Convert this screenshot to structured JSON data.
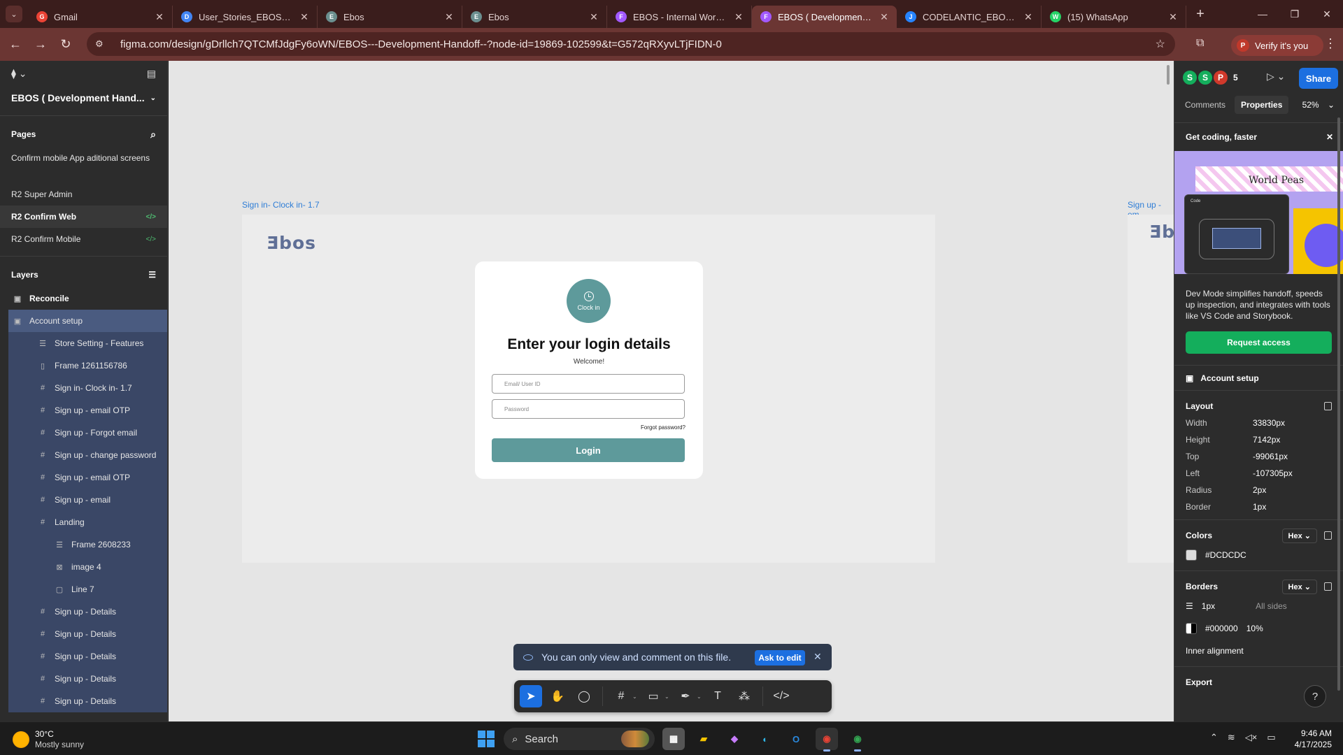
{
  "browser": {
    "tabs": [
      {
        "title": "Gmail",
        "fav": "G",
        "color": "#ea4335",
        "active": false
      },
      {
        "title": "User_Stories_EBOS_V2.1.1",
        "fav": "D",
        "color": "#4285f4",
        "active": false
      },
      {
        "title": "Ebos",
        "fav": "E",
        "color": "#6b8f8f",
        "active": false
      },
      {
        "title": "Ebos",
        "fav": "E",
        "color": "#6b8f8f",
        "active": false
      },
      {
        "title": "EBOS - Internal Workplace",
        "fav": "F",
        "color": "#a259ff",
        "active": false
      },
      {
        "title": "EBOS ( Development Handoff )",
        "fav": "F",
        "color": "#a259ff",
        "active": true
      },
      {
        "title": "CODELANTIC_EBOS - Backlog",
        "fav": "J",
        "color": "#2684ff",
        "active": false
      },
      {
        "title": "(15) WhatsApp",
        "fav": "W",
        "color": "#25d366",
        "active": false
      }
    ],
    "url": "figma.com/design/gDrllch7QTCMfJdgFy6oWN/EBOS---Development-Handoff--?node-id=19869-102599&t=G572qRXyvLTjFIDN-0",
    "verify_label": "Verify it's you",
    "verify_avatar": "P"
  },
  "left": {
    "file_title": "EBOS ( Development Hand...",
    "pages_label": "Pages",
    "pages": [
      {
        "label": "Confirm mobile App aditional screens",
        "selected": false,
        "dev": false
      },
      {
        "label": "R2 Super Admin",
        "selected": false,
        "dev": false
      },
      {
        "label": "R2 Confirm Web",
        "selected": true,
        "dev": true
      },
      {
        "label": "R2 Confirm Mobile",
        "selected": false,
        "dev": true
      }
    ],
    "layers_label": "Layers",
    "layers": [
      {
        "label": "Reconcile",
        "level": "top",
        "icon": "▣"
      },
      {
        "label": "Account setup",
        "level": "sel",
        "icon": "▣"
      },
      {
        "label": "Store Setting - Features",
        "level": "child",
        "icon": "☰"
      },
      {
        "label": "Frame 1261156786",
        "level": "child",
        "icon": "▯"
      },
      {
        "label": "Sign in- Clock in- 1.7",
        "level": "child",
        "icon": "#"
      },
      {
        "label": "Sign up - email OTP",
        "level": "child",
        "icon": "#"
      },
      {
        "label": "Sign up - Forgot email",
        "level": "child",
        "icon": "#"
      },
      {
        "label": "Sign up - change password",
        "level": "child",
        "icon": "#"
      },
      {
        "label": "Sign up - email OTP",
        "level": "child",
        "icon": "#"
      },
      {
        "label": "Sign up - email",
        "level": "child",
        "icon": "#"
      },
      {
        "label": "Landing",
        "level": "child",
        "icon": "#"
      },
      {
        "label": "Frame 2608233",
        "level": "gchild",
        "icon": "☰"
      },
      {
        "label": "image 4",
        "level": "gchild",
        "icon": "⊠"
      },
      {
        "label": "Line 7",
        "level": "gchild",
        "icon": "▢"
      },
      {
        "label": "Sign up - Details",
        "level": "child",
        "icon": "#"
      },
      {
        "label": "Sign up - Details",
        "level": "child",
        "icon": "#"
      },
      {
        "label": "Sign up - Details",
        "level": "child",
        "icon": "#"
      },
      {
        "label": "Sign up - Details",
        "level": "child",
        "icon": "#"
      },
      {
        "label": "Sign up - Details",
        "level": "child",
        "icon": "#"
      }
    ]
  },
  "canvas": {
    "frame1_label": "Sign in- Clock in- 1.7",
    "frame2_label": "Sign up - em",
    "logo": "Ǝbos",
    "logo2": "Ǝb",
    "clock_label": "Clock in",
    "heading": "Enter your login details",
    "welcome": "Welcome!",
    "email_placeholder": "Email/ User ID",
    "password_placeholder": "Password",
    "forgot": "Forgot password?",
    "login": "Login",
    "toast_text": "You can only view and comment on this file.",
    "toast_button": "Ask to edit"
  },
  "right": {
    "avatars": [
      {
        "letter": "S",
        "color": "#14ae5c"
      },
      {
        "letter": "S",
        "color": "#14ae5c"
      },
      {
        "letter": "P",
        "color": "#d0392b"
      }
    ],
    "avatar_count": "5",
    "share": "Share",
    "tab_comments": "Comments",
    "tab_properties": "Properties",
    "zoom": "52%",
    "promo_title": "Get coding, faster",
    "promo_wp": "World Peas",
    "promo_code_label": "Code",
    "promo_text": "Dev Mode simplifies handoff, speeds up inspection, and integrates with tools like VS Code and Storybook.",
    "request_access": "Request access",
    "selected_layer": "Account setup",
    "layout_label": "Layout",
    "layout": [
      {
        "k": "Width",
        "v": "33830px"
      },
      {
        "k": "Height",
        "v": "7142px"
      },
      {
        "k": "Top",
        "v": "-99061px"
      },
      {
        "k": "Left",
        "v": "-107305px"
      },
      {
        "k": "Radius",
        "v": "2px"
      },
      {
        "k": "Border",
        "v": "1px"
      }
    ],
    "colors_label": "Colors",
    "hex_label": "Hex",
    "fill_hex": "#DCDCDC",
    "borders_label": "Borders",
    "border_width": "1px",
    "border_sides": "All sides",
    "border_hex": "#000000",
    "border_opacity": "10%",
    "inner_alignment": "Inner alignment",
    "export_label": "Export"
  },
  "taskbar": {
    "temp": "30°C",
    "weather": "Mostly sunny",
    "search": "Search",
    "time": "9:46 AM",
    "date": "4/17/2025"
  }
}
